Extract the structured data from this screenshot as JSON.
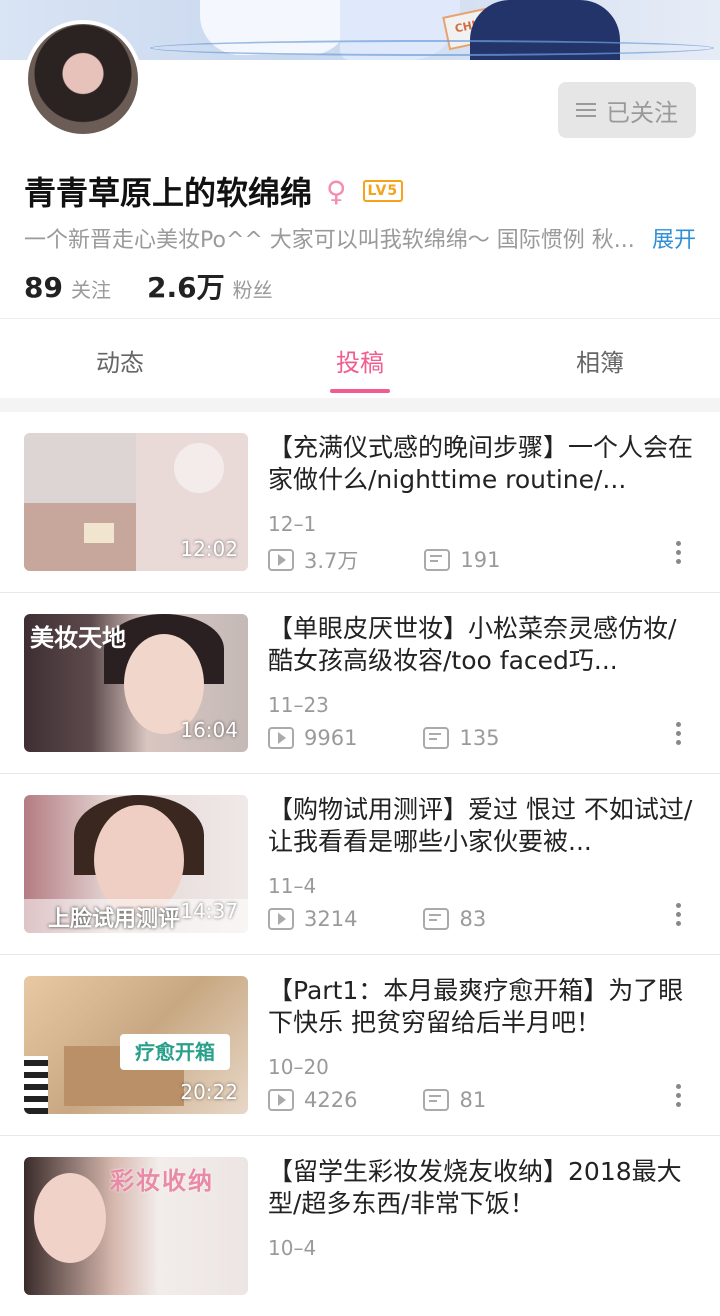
{
  "profile": {
    "name": "青青草原上的软绵绵",
    "level": "LV5",
    "bio": "一个新晋走心美妆Po^^ 大家可以叫我软绵绵～ 国际惯例 秋...",
    "expand_label": "展开",
    "follow_button": "已关注",
    "following_count": "89",
    "following_label": "关注",
    "fans_count": "2.6万",
    "fans_label": "粉丝"
  },
  "tabs": [
    {
      "label": "动态",
      "active": false
    },
    {
      "label": "投稿",
      "active": true
    },
    {
      "label": "相簿",
      "active": false
    }
  ],
  "videos": [
    {
      "title": "【充满仪式感的晚间步骤】一个人会在家做什么/nighttime routine/...",
      "date": "12–1",
      "views": "3.7万",
      "danmaku": "191",
      "duration": "12:02"
    },
    {
      "title": "【单眼皮厌世妆】小松菜奈灵感仿妆/酷女孩高级妆容/too faced巧...",
      "date": "11–23",
      "views": "9961",
      "danmaku": "135",
      "duration": "16:04",
      "thumb_text": "美妆天地"
    },
    {
      "title": "【购物试用测评】爱过 恨过 不如试过/让我看看是哪些小家伙要被...",
      "date": "11–4",
      "views": "3214",
      "danmaku": "83",
      "duration": "14:37",
      "thumb_text": "上脸试用测评"
    },
    {
      "title": "【Part1：本月最爽疗愈开箱】为了眼下快乐 把贫穷留给后半月吧！",
      "date": "10–20",
      "views": "4226",
      "danmaku": "81",
      "duration": "20:22",
      "thumb_text": "疗愈开箱"
    },
    {
      "title": "【留学生彩妆发烧友收纳】2018最大型/超多东西/非常下饭！",
      "date": "10–4",
      "views": "",
      "danmaku": "",
      "duration": "",
      "thumb_text": "彩妆收纳"
    }
  ],
  "colors": {
    "accent": "#f25d8e",
    "link": "#2f8fd8",
    "level": "#f6a21a"
  }
}
